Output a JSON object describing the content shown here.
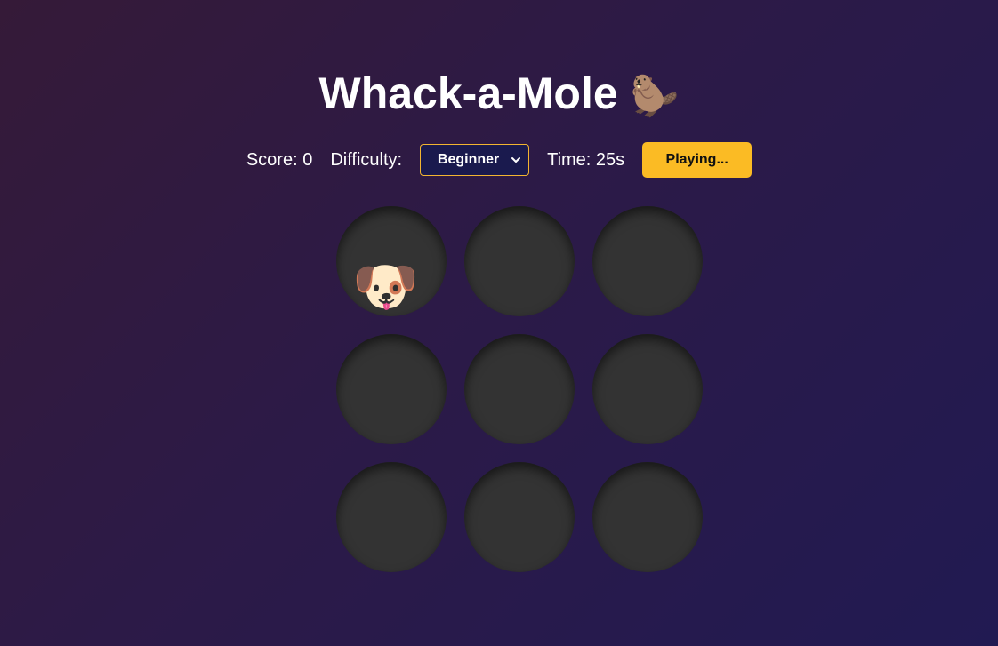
{
  "title": "Whack-a-Mole",
  "title_icon": "🦫",
  "controls": {
    "score_label": "Score: 0",
    "difficulty_label": "Difficulty:",
    "difficulty_value": "Beginner",
    "time_label": "Time: 25s",
    "play_button": "Playing..."
  },
  "holes": [
    {
      "critter": "🐶",
      "critter_icon": "dog-icon"
    },
    {
      "critter": ""
    },
    {
      "critter": ""
    },
    {
      "critter": ""
    },
    {
      "critter": ""
    },
    {
      "critter": ""
    },
    {
      "critter": ""
    },
    {
      "critter": ""
    },
    {
      "critter": ""
    }
  ],
  "colors": {
    "accent": "#fbbb24",
    "select_bg": "#1a1a4e",
    "select_border": "#f2b531",
    "hole": "#333333"
  }
}
